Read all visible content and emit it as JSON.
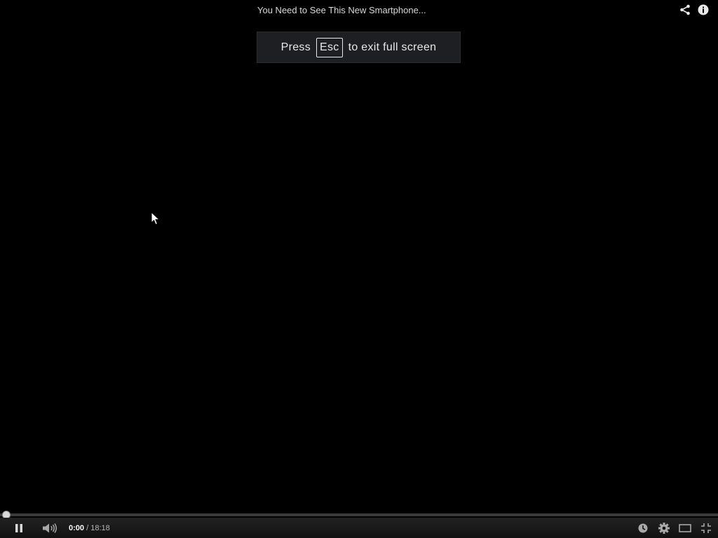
{
  "video": {
    "title": "You Need to See This New Smartphone..."
  },
  "esc_notice": {
    "prefix": "Press",
    "key": "Esc",
    "suffix": "to exit full screen"
  },
  "top_icons": [
    "share-icon",
    "info-icon"
  ],
  "playback": {
    "current_time": "0:00",
    "separator": "/",
    "duration": "18:18",
    "progress_fraction": 0.0
  },
  "controls": {
    "left": [
      "pause-icon",
      "volume-icon"
    ],
    "right": [
      "watch-later-icon",
      "settings-icon",
      "theater-mode-icon",
      "exit-fullscreen-icon"
    ]
  },
  "colors": {
    "background": "#000000",
    "progress_played": "#cc0000",
    "progress_track": "#3a3a3a"
  }
}
